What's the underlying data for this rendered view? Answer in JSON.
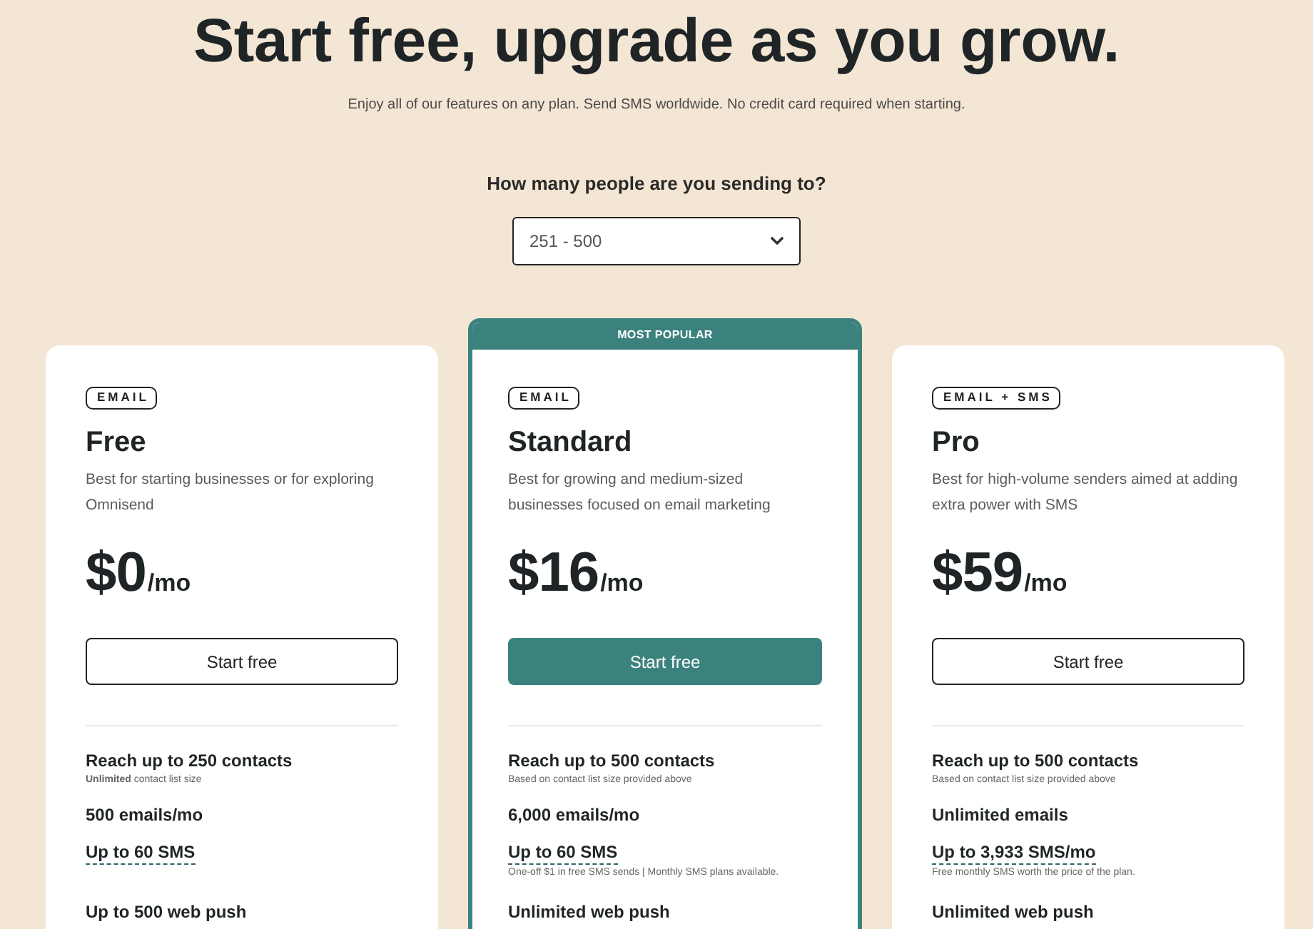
{
  "heading": {
    "title": "Start free, upgrade as you grow.",
    "subtitle": "Enjoy all of our features on any plan. Send SMS worldwide. No credit card required when starting."
  },
  "audience": {
    "question": "How many people are you sending to?",
    "value": "251 - 500"
  },
  "plans": [
    {
      "featured": false,
      "channel": "EMAIL",
      "name": "Free",
      "description": "Best for starting businesses or for exploring Omnisend",
      "price": "$0",
      "period": "/mo",
      "button": "Start free",
      "features": [
        {
          "title": "Reach up to 250 contacts",
          "note": "**Unlimited** contact list size",
          "underlined": false
        },
        {
          "title": "500 emails/mo",
          "underlined": false
        },
        {
          "title": "Up to 60 SMS",
          "underlined": true
        },
        {
          "title": "Up to 500 web push",
          "underlined": false
        }
      ]
    },
    {
      "featured": true,
      "ribbon": "MOST POPULAR",
      "channel": "EMAIL",
      "name": "Standard",
      "description": "Best for growing and medium-sized businesses focused on email marketing",
      "price": "$16",
      "period": "/mo",
      "button": "Start free",
      "features": [
        {
          "title": "Reach up to 500 contacts",
          "note": "Based on contact list size provided above",
          "underlined": false
        },
        {
          "title": "6,000 emails/mo",
          "underlined": false
        },
        {
          "title": "Up to 60 SMS",
          "note": "One-off $1 in free SMS sends | Monthly SMS plans available.",
          "underlined": true
        },
        {
          "title": "Unlimited web push",
          "underlined": false
        }
      ]
    },
    {
      "featured": false,
      "channel": "EMAIL + SMS",
      "name": "Pro",
      "description": "Best for high-volume senders aimed at adding extra power with SMS",
      "price": "$59",
      "period": "/mo",
      "button": "Start free",
      "features": [
        {
          "title": "Reach up to 500 contacts",
          "note": "Based on contact list size provided above",
          "underlined": false
        },
        {
          "title": "Unlimited emails",
          "underlined": false
        },
        {
          "title": "Up to 3,933 SMS/mo",
          "note": "Free monthly SMS worth the price of the plan.",
          "underlined": true
        },
        {
          "title": "Unlimited web push",
          "underlined": false
        }
      ]
    }
  ]
}
